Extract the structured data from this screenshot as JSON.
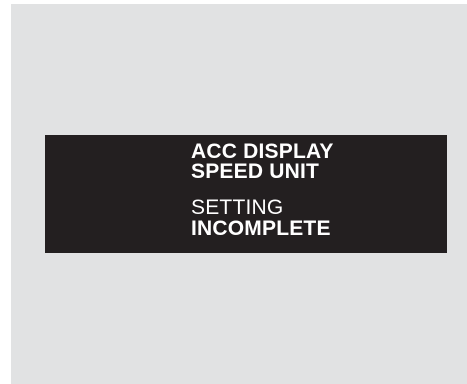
{
  "display": {
    "title_line1": "ACC DISPLAY",
    "title_line2": "SPEED UNIT",
    "status_line1": "SETTING",
    "status_line2": "INCOMPLETE"
  },
  "colors": {
    "frame_background": "#e1e2e3",
    "panel_background": "#231f20",
    "text": "#ffffff"
  }
}
